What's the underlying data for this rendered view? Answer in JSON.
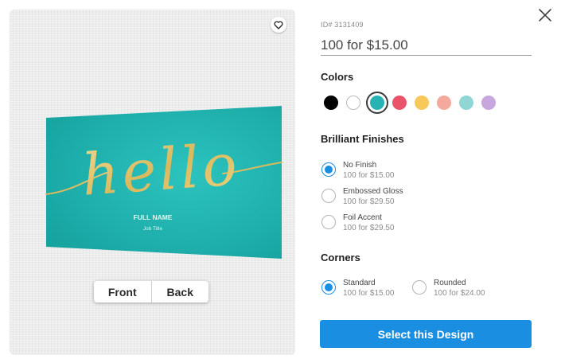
{
  "preview": {
    "card": {
      "headline": "hello",
      "name": "FULL NAME",
      "job_title": "Job Title",
      "card_color": "#1fb3b0",
      "script_color": "#e2c572"
    },
    "views": [
      "Front",
      "Back"
    ],
    "favorite_icon": "heart-icon"
  },
  "close_icon": "close-icon",
  "product": {
    "id_text": "ID# 3131409",
    "price_selected": "100 for $15.00"
  },
  "colors": {
    "title": "Colors",
    "swatches": [
      {
        "name": "black",
        "hex": "#000000"
      },
      {
        "name": "white",
        "hex": "#ffffff"
      },
      {
        "name": "teal",
        "hex": "#27b3b3",
        "selected": true
      },
      {
        "name": "red-pink",
        "hex": "#e9546b"
      },
      {
        "name": "yellow",
        "hex": "#f7c85a"
      },
      {
        "name": "peach",
        "hex": "#f3aa9c"
      },
      {
        "name": "light-teal",
        "hex": "#8fd6d4"
      },
      {
        "name": "lavender",
        "hex": "#c7a7de"
      }
    ]
  },
  "finishes": {
    "title": "Brilliant Finishes",
    "options": [
      {
        "label": "No Finish",
        "price": "100 for $15.00",
        "selected": true
      },
      {
        "label": "Embossed Gloss",
        "price": "100 for $29.50",
        "selected": false
      },
      {
        "label": "Foil Accent",
        "price": "100 for $29.50",
        "selected": false
      }
    ]
  },
  "corners": {
    "title": "Corners",
    "options": [
      {
        "label": "Standard",
        "price": "100 for $15.00",
        "selected": true
      },
      {
        "label": "Rounded",
        "price": "100 for $24.00",
        "selected": false
      }
    ]
  },
  "cta_label": "Select this Design",
  "accent_color": "#1a8ee1"
}
